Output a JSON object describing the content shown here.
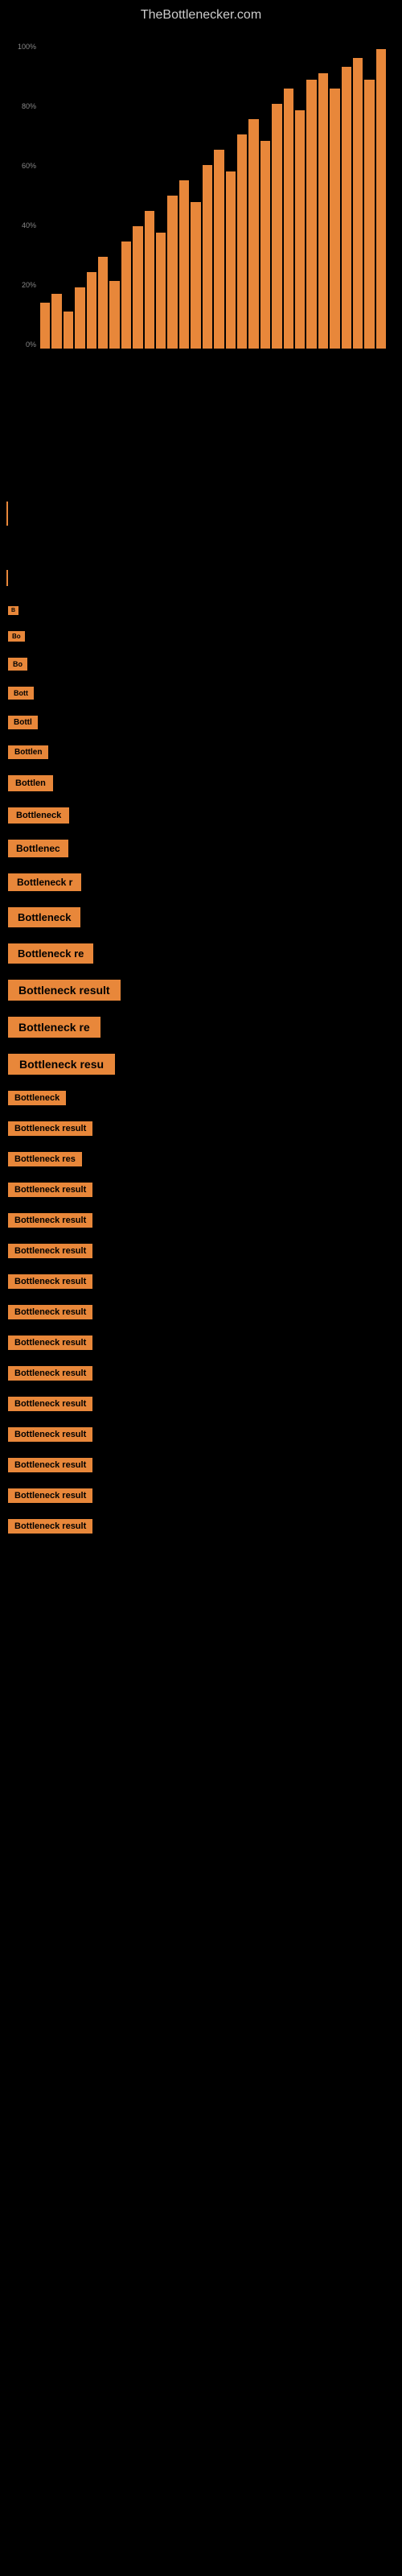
{
  "site": {
    "title": "TheBottlenecker.com"
  },
  "chart": {
    "y_axis_labels": [
      "100%",
      "80%",
      "60%",
      "40%",
      "20%",
      "0%"
    ],
    "x_axis_labels": [
      "",
      "",
      "",
      "",
      "",
      "",
      "",
      "",
      "",
      ""
    ],
    "bars": [
      {
        "height": 15
      },
      {
        "height": 18
      },
      {
        "height": 12
      },
      {
        "height": 20
      },
      {
        "height": 25
      },
      {
        "height": 30
      },
      {
        "height": 22
      },
      {
        "height": 35
      },
      {
        "height": 40
      },
      {
        "height": 45
      },
      {
        "height": 38
      },
      {
        "height": 50
      },
      {
        "height": 55
      },
      {
        "height": 48
      },
      {
        "height": 60
      },
      {
        "height": 65
      },
      {
        "height": 58
      },
      {
        "height": 70
      },
      {
        "height": 75
      },
      {
        "height": 68
      },
      {
        "height": 80
      },
      {
        "height": 85
      },
      {
        "height": 78
      },
      {
        "height": 88
      },
      {
        "height": 90
      },
      {
        "height": 85
      },
      {
        "height": 92
      },
      {
        "height": 95
      },
      {
        "height": 88
      },
      {
        "height": 98
      }
    ]
  },
  "results": [
    {
      "label": "B",
      "id": 1
    },
    {
      "label": "Bo",
      "id": 2
    },
    {
      "label": "Bo",
      "id": 3
    },
    {
      "label": "Bott",
      "id": 4
    },
    {
      "label": "Bottl",
      "id": 5
    },
    {
      "label": "Bottlen",
      "id": 6
    },
    {
      "label": "Bottlen",
      "id": 7
    },
    {
      "label": "Bottleneck",
      "id": 8
    },
    {
      "label": "Bottlenec",
      "id": 9
    },
    {
      "label": "Bottleneck r",
      "id": 10
    },
    {
      "label": "Bottleneck",
      "id": 11
    },
    {
      "label": "Bottleneck re",
      "id": 12
    },
    {
      "label": "Bottleneck result",
      "id": 13
    },
    {
      "label": "Bottleneck re",
      "id": 14
    },
    {
      "label": "Bottleneck resu",
      "id": 15
    },
    {
      "label": "Bottleneck",
      "id": 16
    },
    {
      "label": "Bottleneck result",
      "id": 17
    },
    {
      "label": "Bottleneck res",
      "id": 18
    },
    {
      "label": "Bottleneck result",
      "id": 19
    },
    {
      "label": "Bottleneck result",
      "id": 20
    },
    {
      "label": "Bottleneck result",
      "id": 21
    },
    {
      "label": "Bottleneck result",
      "id": 22
    },
    {
      "label": "Bottleneck result",
      "id": 23
    },
    {
      "label": "Bottleneck result",
      "id": 24
    },
    {
      "label": "Bottleneck result",
      "id": 25
    },
    {
      "label": "Bottleneck result",
      "id": 26
    },
    {
      "label": "Bottleneck result",
      "id": 27
    },
    {
      "label": "Bottleneck result",
      "id": 28
    },
    {
      "label": "Bottleneck result",
      "id": 29
    },
    {
      "label": "Bottleneck result",
      "id": 30
    }
  ]
}
